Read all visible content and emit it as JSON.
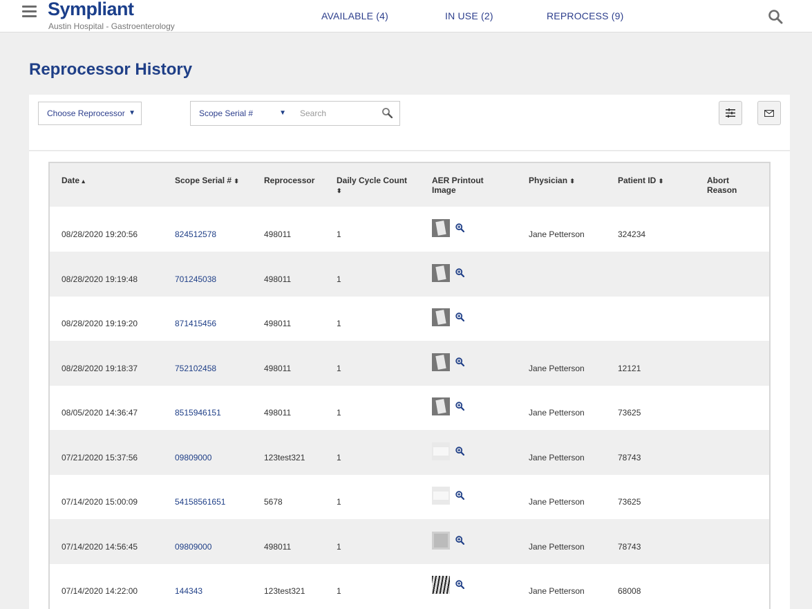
{
  "header": {
    "logo": "Sympliant",
    "subtitle": "Austin Hospital - Gastroenterology",
    "nav": [
      "AVAILABLE (4)",
      "IN USE (2)",
      "REPROCESS (9)"
    ]
  },
  "page_title": "Reprocessor History",
  "filters": {
    "reprocessor_select": "Choose Reprocessor",
    "field_select": "Scope Serial #",
    "search_placeholder": "Search"
  },
  "icons": {
    "menu": "hamburger-icon",
    "search": "search-icon",
    "filter": "sliders-icon",
    "email": "envelope-icon",
    "zoom": "zoom-in-icon"
  },
  "table": {
    "columns": [
      "Date",
      "Scope Serial #",
      "Reprocessor",
      "Daily Cycle Count",
      "AER Printout Image",
      "Physician",
      "Patient ID",
      "Abort Reason"
    ],
    "sort_ascending_glyph": "▴",
    "sortable_glyph": "⬍",
    "rows": [
      {
        "date": "08/28/2020 19:20:56",
        "serial": "824512578",
        "reprocessor": "498011",
        "cycle": "1",
        "physician": "Jane Petterson",
        "patient_id": "324234",
        "abort": ""
      },
      {
        "date": "08/28/2020 19:19:48",
        "serial": "701245038",
        "reprocessor": "498011",
        "cycle": "1",
        "physician": "",
        "patient_id": "",
        "abort": ""
      },
      {
        "date": "08/28/2020 19:19:20",
        "serial": "871415456",
        "reprocessor": "498011",
        "cycle": "1",
        "physician": "",
        "patient_id": "",
        "abort": ""
      },
      {
        "date": "08/28/2020 19:18:37",
        "serial": "752102458",
        "reprocessor": "498011",
        "cycle": "1",
        "physician": "Jane Petterson",
        "patient_id": "12121",
        "abort": ""
      },
      {
        "date": "08/05/2020 14:36:47",
        "serial": "8515946151",
        "reprocessor": "498011",
        "cycle": "1",
        "physician": "Jane Petterson",
        "patient_id": "73625",
        "abort": ""
      },
      {
        "date": "07/21/2020 15:37:56",
        "serial": "09809000",
        "reprocessor": "123test321",
        "cycle": "1",
        "physician": "Jane Petterson",
        "patient_id": "78743",
        "abort": ""
      },
      {
        "date": "07/14/2020 15:00:09",
        "serial": "54158561651",
        "reprocessor": "5678",
        "cycle": "1",
        "physician": "Jane Petterson",
        "patient_id": "73625",
        "abort": ""
      },
      {
        "date": "07/14/2020 14:56:45",
        "serial": "09809000",
        "reprocessor": "498011",
        "cycle": "1",
        "physician": "Jane Petterson",
        "patient_id": "78743",
        "abort": ""
      },
      {
        "date": "07/14/2020 14:22:00",
        "serial": "144343",
        "reprocessor": "123test321",
        "cycle": "1",
        "physician": "Jane Petterson",
        "patient_id": "68008",
        "abort": ""
      }
    ]
  }
}
